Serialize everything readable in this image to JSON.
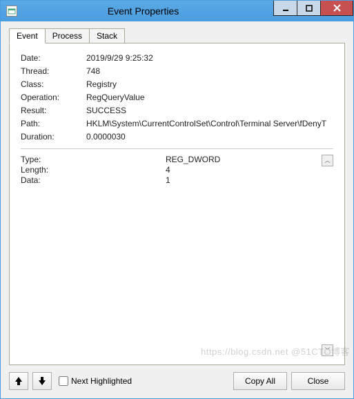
{
  "window": {
    "title": "Event Properties"
  },
  "tabs": {
    "event": "Event",
    "process": "Process",
    "stack": "Stack"
  },
  "labels": {
    "date": "Date:",
    "thread": "Thread:",
    "class": "Class:",
    "operation": "Operation:",
    "result": "Result:",
    "path": "Path:",
    "duration": "Duration:",
    "type": "Type:",
    "length": "Length:",
    "data": "Data:"
  },
  "values": {
    "date": "2019/9/29 9:25:32",
    "thread": "748",
    "class": "Registry",
    "operation": "RegQueryValue",
    "result": "SUCCESS",
    "path": "HKLM\\System\\CurrentControlSet\\Control\\Terminal Server\\fDenyT",
    "duration": "0.0000030",
    "type": "REG_DWORD",
    "length": "4",
    "data": "1"
  },
  "controls": {
    "next_highlighted": "Next Highlighted",
    "copy_all": "Copy All",
    "close": "Close"
  },
  "glyphs": {
    "up": "▲",
    "down": "▼",
    "arrow_up": "⬆",
    "arrow_down": "⬇",
    "bars": "≡"
  },
  "watermark": "https://blog.csdn.net  @51CTO博客"
}
